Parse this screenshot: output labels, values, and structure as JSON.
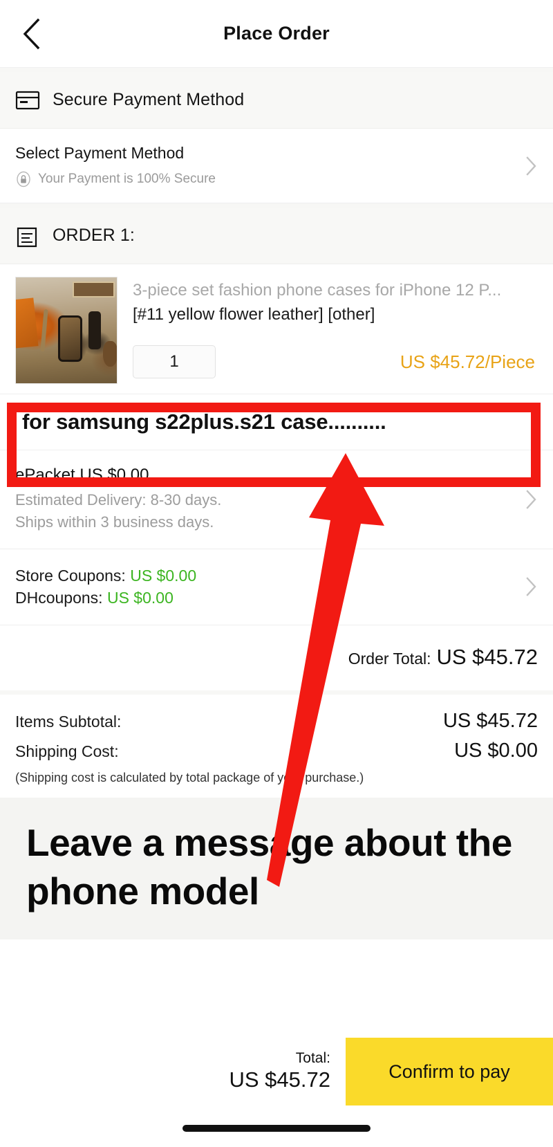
{
  "header": {
    "title": "Place Order",
    "back_icon": "chevron-left-icon"
  },
  "payment_section": {
    "header_title": "Secure Payment Method",
    "header_icon": "credit-card-icon",
    "select_title": "Select Payment Method",
    "secure_note": "Your Payment is 100% Secure",
    "lock_icon": "lock-circle-icon",
    "chevron_icon": "chevron-right-icon"
  },
  "order_section": {
    "header_title": "ORDER 1:",
    "header_icon": "order-list-icon",
    "product": {
      "name": "3-piece set fashion phone cases for iPhone 12 P...",
      "attributes": "[#11 yellow flower leather] [other]",
      "quantity": "1",
      "price": "US $45.72/Piece",
      "price_color": "#e8a317",
      "image_alt": "phone-case-product-photo"
    },
    "buyer_note": {
      "value": "for samsung s22plus.s21 case..........",
      "placeholder": "Leave a message"
    },
    "shipping": {
      "method": "ePacket US $0.00",
      "estimated": "Estimated Delivery: 8-30 days.",
      "handling": "Ships within 3 business days.",
      "chevron_icon": "chevron-right-icon"
    },
    "coupons": {
      "store_label": "Store Coupons:",
      "store_value": "US $0.00",
      "dh_label": "DHcoupons:",
      "dh_value": "US $0.00",
      "value_color": "#3cb521",
      "chevron_icon": "chevron-right-icon"
    },
    "order_total_label": "Order Total:",
    "order_total_value": "US $45.72"
  },
  "summary": {
    "items_subtotal_label": "Items Subtotal:",
    "items_subtotal_value": "US $45.72",
    "shipping_cost_label": "Shipping Cost:",
    "shipping_cost_value": "US $0.00",
    "note": "(Shipping cost is calculated by total package of your purchase.)"
  },
  "caption": {
    "text": "Leave a message about the phone model"
  },
  "bottom_bar": {
    "total_label": "Total:",
    "total_value": "US $45.72",
    "confirm_label": "Confirm to pay",
    "confirm_color": "#fada2a"
  },
  "annotation": {
    "highlight_color": "#f21a13",
    "shapes": [
      "red-rectangle-around-message-field",
      "red-arrow-pointing-up-to-message-field"
    ]
  }
}
